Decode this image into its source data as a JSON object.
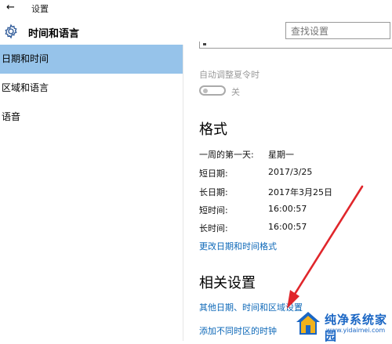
{
  "window": {
    "back_glyph": "←",
    "title": "设置"
  },
  "header": {
    "title": "时间和语言",
    "icon": "gear-icon",
    "search_placeholder": "查找设置"
  },
  "sidebar": {
    "items": [
      {
        "label": "日期和时间",
        "active": true
      },
      {
        "label": "区域和语言",
        "active": false
      },
      {
        "label": "语音",
        "active": false
      }
    ]
  },
  "content": {
    "dst": {
      "label": "自动调整夏令时",
      "state": "关",
      "on": false
    },
    "format": {
      "title": "格式",
      "rows": [
        {
          "label": "一周的第一天:",
          "value": "星期一"
        },
        {
          "label": "短日期:",
          "value": "2017/3/25"
        },
        {
          "label": "长日期:",
          "value": "2017年3月25日"
        },
        {
          "label": "短时间:",
          "value": "16:00:57"
        },
        {
          "label": "长时间:",
          "value": "16:00:57"
        }
      ],
      "change_link": "更改日期和时间格式"
    },
    "related": {
      "title": "相关设置",
      "links": [
        "其他日期、时间和区域设置",
        "添加不同时区的时钟"
      ]
    }
  },
  "watermark": {
    "title": "纯净系统家园",
    "url": "www.yidaimei.com"
  },
  "colors": {
    "accent": "#96c3ea",
    "link": "#0d68b8",
    "arrow": "#e0262b",
    "watermark": "#1a66c4"
  }
}
